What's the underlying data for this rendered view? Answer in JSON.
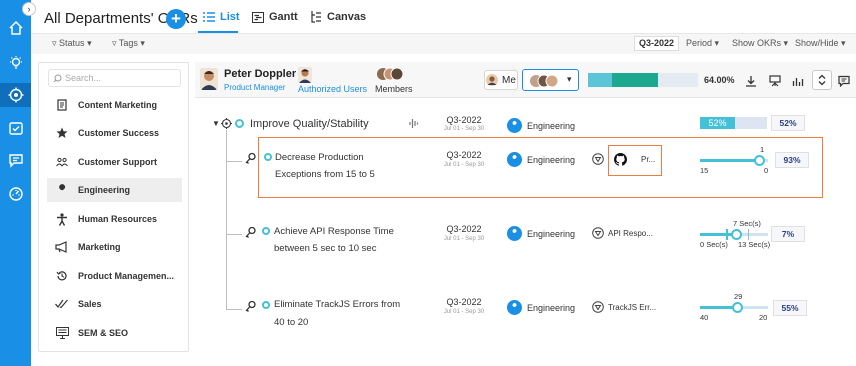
{
  "header": {
    "title": "All Departments' OKRs",
    "add_label": "+",
    "collapse_label": "›",
    "views": [
      {
        "label": "List",
        "active": true
      },
      {
        "label": "Gantt",
        "active": false
      },
      {
        "label": "Canvas",
        "active": false
      }
    ]
  },
  "filters": {
    "status_label": "Status",
    "tags_label": "Tags",
    "period_value": "Q3-2022",
    "period_label": "Period",
    "show_okrs_label": "Show OKRs",
    "show_hide_label": "Show/Hide"
  },
  "sidebar": {
    "search_placeholder": "Search...",
    "departments": [
      {
        "label": "Content Marketing",
        "icon": "document-icon",
        "selected": false
      },
      {
        "label": "Customer Success",
        "icon": "star-icon",
        "selected": false
      },
      {
        "label": "Customer Support",
        "icon": "people-icon",
        "selected": false
      },
      {
        "label": "Engineering",
        "icon": "wrench-icon",
        "selected": true
      },
      {
        "label": "Human Resources",
        "icon": "person-icon",
        "selected": false
      },
      {
        "label": "Marketing",
        "icon": "megaphone-icon",
        "selected": false
      },
      {
        "label": "Product Managemen...",
        "icon": "history-icon",
        "selected": false
      },
      {
        "label": "Sales",
        "icon": "checkmarks-icon",
        "selected": false
      },
      {
        "label": "SEM & SEO",
        "icon": "monitor-icon",
        "selected": false
      }
    ]
  },
  "userbar": {
    "name": "Peter Doppler",
    "role": "Product Manager",
    "authorized_users_label": "Authorized Users",
    "members_label": "Members",
    "me_label": "Me",
    "overall_progress": 0.64,
    "overall_progress_label": "64.00%"
  },
  "objective": {
    "title": "Improve Quality/Stability",
    "quarter": "Q3-2022",
    "dates": "Jul 01 - Sep 30",
    "team": "Engineering",
    "progress": 0.52,
    "progress_label": "52%",
    "pct_label": "52%"
  },
  "key_results": [
    {
      "title_line1": "Decrease Production",
      "title_line2": "Exceptions from 15 to 5",
      "quarter": "Q3-2022",
      "dates": "Jul 01 - Sep 30",
      "team": "Engineering",
      "linked": "Pr...",
      "linked_icon": "github-icon",
      "slider_start": "15",
      "slider_end": "0",
      "slider_current": "1",
      "progress": 0.93,
      "pct_label": "93%"
    },
    {
      "title_line1": "Achieve API Response Time",
      "title_line2": "between 5 sec to 10 sec",
      "quarter": "Q3-2022",
      "dates": "Jul 01 - Sep 30",
      "team": "Engineering",
      "linked": "API Respo...",
      "linked_icon": "shield-icon",
      "slider_start": "0 Sec(s)",
      "slider_end": "13 Sec(s)",
      "slider_current": "7 Sec(s)",
      "progress": 0.07,
      "pct_label": "7%"
    },
    {
      "title_line1": "Eliminate TrackJS Errors from",
      "title_line2": "40 to 20",
      "quarter": "Q3-2022",
      "dates": "Jul 01 - Sep 30",
      "team": "Engineering",
      "linked": "TrackJS Err...",
      "linked_icon": "shield-icon",
      "slider_start": "40",
      "slider_end": "20",
      "slider_current": "29",
      "progress": 0.55,
      "pct_label": "55%"
    }
  ],
  "colors": {
    "accent": "#1a8fe6",
    "progress_cyan": "#44c1d6",
    "progress_teal": "#1fa890",
    "highlight": "#f07b3f"
  }
}
